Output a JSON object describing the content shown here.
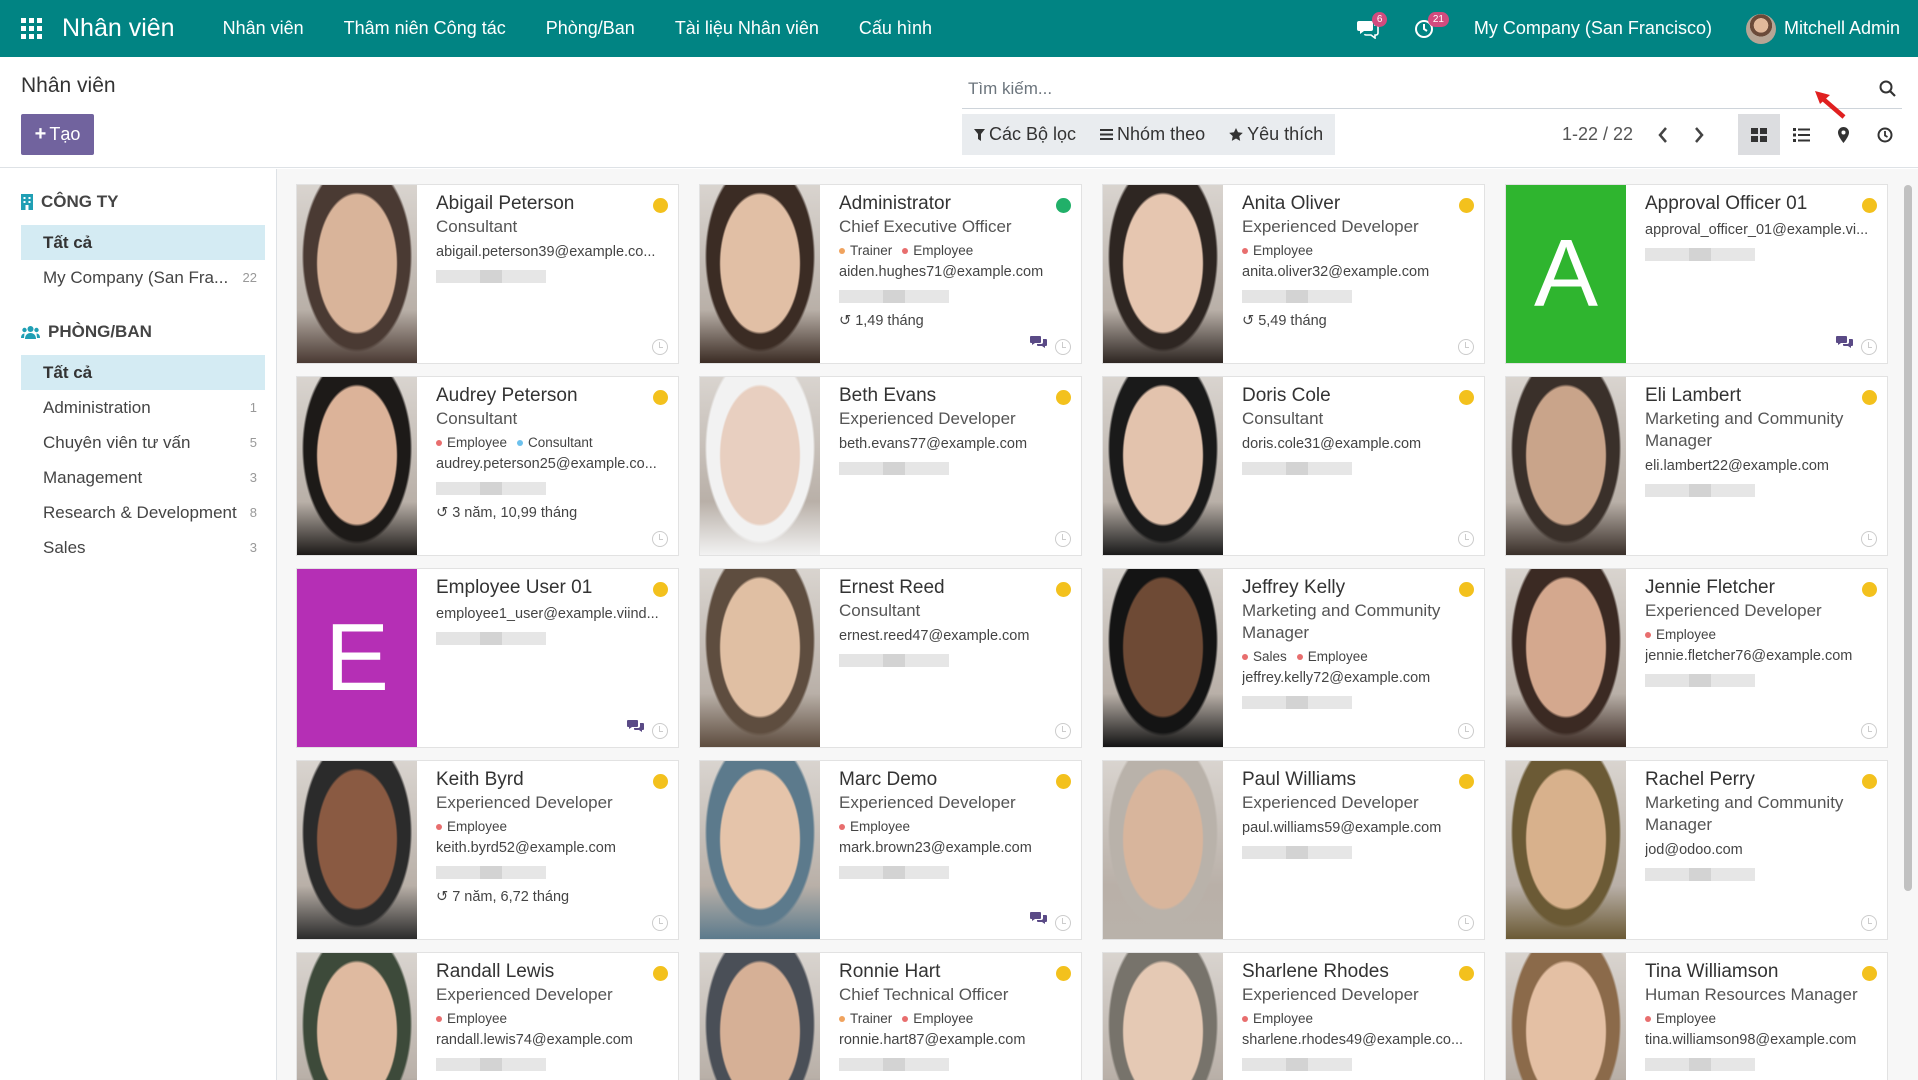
{
  "navbar": {
    "app_name": "Nhân viên",
    "menu": [
      "Nhân viên",
      "Thâm niên Công tác",
      "Phòng/Ban",
      "Tài liệu Nhân viên",
      "Cấu hình"
    ],
    "messages_count": "6",
    "activities_count": "21",
    "company": "My Company (San Francisco)",
    "user": "Mitchell Admin"
  },
  "control": {
    "breadcrumb": "Nhân viên",
    "create_label": "Tạo",
    "search_placeholder": "Tìm kiếm...",
    "filters_label": "Các Bộ lọc",
    "groupby_label": "Nhóm theo",
    "favorites_label": "Yêu thích",
    "pager": "1-22 / 22"
  },
  "sidebar": {
    "company_title": "CÔNG TY",
    "company_items": [
      {
        "label": "Tất cả",
        "count": ""
      },
      {
        "label": "My Company (San Fra...",
        "count": "22"
      }
    ],
    "dept_title": "PHÒNG/BAN",
    "dept_items": [
      {
        "label": "Tất cả",
        "count": ""
      },
      {
        "label": "Administration",
        "count": "1"
      },
      {
        "label": "Chuyên viên tư vấn",
        "count": "5"
      },
      {
        "label": "Management",
        "count": "3"
      },
      {
        "label": "Research & Development",
        "count": "8"
      },
      {
        "label": "Sales",
        "count": "3"
      }
    ]
  },
  "colors": {
    "brand": "#018483",
    "primary": "#71639e",
    "status_away": "#f3c11d",
    "status_online": "#21b069",
    "tag_trainer": "#f0a35e",
    "tag_employee": "#e86e6e",
    "tag_consultant": "#6cc1ed",
    "tag_sales": "#e86e6e"
  },
  "employees": [
    {
      "name": "Abigail Peterson",
      "job": "Consultant",
      "tags": [],
      "email": "abigail.peterson39@example.co...",
      "tenure": "",
      "status": "away",
      "chat": false
    },
    {
      "name": "Administrator",
      "job": "Chief Executive Officer",
      "tags": [
        {
          "label": "Trainer",
          "color": "#f0a35e"
        },
        {
          "label": "Employee",
          "color": "#e86e6e"
        }
      ],
      "email": "aiden.hughes71@example.com",
      "tenure": "1,49 tháng",
      "status": "online",
      "chat": true
    },
    {
      "name": "Anita Oliver",
      "job": "Experienced Developer",
      "tags": [
        {
          "label": "Employee",
          "color": "#e86e6e"
        }
      ],
      "email": "anita.oliver32@example.com",
      "tenure": "5,49 tháng",
      "status": "away",
      "chat": false
    },
    {
      "name": "Approval Officer 01",
      "job": "",
      "tags": [],
      "email": "approval_officer_01@example.vi...",
      "tenure": "",
      "status": "away",
      "chat": true,
      "initial": "A",
      "initial_color": "#2fb52f"
    },
    {
      "name": "Audrey Peterson",
      "job": "Consultant",
      "tags": [
        {
          "label": "Employee",
          "color": "#e86e6e"
        },
        {
          "label": "Consultant",
          "color": "#6cc1ed"
        }
      ],
      "email": "audrey.peterson25@example.co...",
      "tenure": "3 năm, 10,99 tháng",
      "status": "away",
      "chat": false
    },
    {
      "name": "Beth Evans",
      "job": "Experienced Developer",
      "tags": [],
      "email": "beth.evans77@example.com",
      "tenure": "",
      "status": "away",
      "chat": false
    },
    {
      "name": "Doris Cole",
      "job": "Consultant",
      "tags": [],
      "email": "doris.cole31@example.com",
      "tenure": "",
      "status": "away",
      "chat": false
    },
    {
      "name": "Eli Lambert",
      "job": "Marketing and Community Manager",
      "tags": [],
      "email": "eli.lambert22@example.com",
      "tenure": "",
      "status": "away",
      "chat": false
    },
    {
      "name": "Employee User 01",
      "job": "",
      "tags": [],
      "email": "employee1_user@example.viind...",
      "tenure": "",
      "status": "away",
      "chat": true,
      "initial": "E",
      "initial_color": "#b52fb5"
    },
    {
      "name": "Ernest Reed",
      "job": "Consultant",
      "tags": [],
      "email": "ernest.reed47@example.com",
      "tenure": "",
      "status": "away",
      "chat": false
    },
    {
      "name": "Jeffrey Kelly",
      "job": "Marketing and Community Manager",
      "tags": [
        {
          "label": "Sales",
          "color": "#e86e6e"
        },
        {
          "label": "Employee",
          "color": "#e86e6e"
        }
      ],
      "email": "jeffrey.kelly72@example.com",
      "tenure": "",
      "status": "away",
      "chat": false
    },
    {
      "name": "Jennie Fletcher",
      "job": "Experienced Developer",
      "tags": [
        {
          "label": "Employee",
          "color": "#e86e6e"
        }
      ],
      "email": "jennie.fletcher76@example.com",
      "tenure": "",
      "status": "away",
      "chat": false
    },
    {
      "name": "Keith Byrd",
      "job": "Experienced Developer",
      "tags": [
        {
          "label": "Employee",
          "color": "#e86e6e"
        }
      ],
      "email": "keith.byrd52@example.com",
      "tenure": "7 năm, 6,72 tháng",
      "status": "away",
      "chat": false
    },
    {
      "name": "Marc Demo",
      "job": "Experienced Developer",
      "tags": [
        {
          "label": "Employee",
          "color": "#e86e6e"
        }
      ],
      "email": "mark.brown23@example.com",
      "tenure": "",
      "status": "away",
      "chat": true
    },
    {
      "name": "Paul Williams",
      "job": "Experienced Developer",
      "tags": [],
      "email": "paul.williams59@example.com",
      "tenure": "",
      "status": "away",
      "chat": false
    },
    {
      "name": "Rachel Perry",
      "job": "Marketing and Community Manager",
      "tags": [],
      "email": "jod@odoo.com",
      "tenure": "",
      "status": "away",
      "chat": false
    },
    {
      "name": "Randall Lewis",
      "job": "Experienced Developer",
      "tags": [
        {
          "label": "Employee",
          "color": "#e86e6e"
        }
      ],
      "email": "randall.lewis74@example.com",
      "tenure": "",
      "status": "away",
      "chat": false
    },
    {
      "name": "Ronnie Hart",
      "job": "Chief Technical Officer",
      "tags": [
        {
          "label": "Trainer",
          "color": "#f0a35e"
        },
        {
          "label": "Employee",
          "color": "#e86e6e"
        }
      ],
      "email": "ronnie.hart87@example.com",
      "tenure": "",
      "status": "away",
      "chat": false
    },
    {
      "name": "Sharlene Rhodes",
      "job": "Experienced Developer",
      "tags": [
        {
          "label": "Employee",
          "color": "#e86e6e"
        }
      ],
      "email": "sharlene.rhodes49@example.co...",
      "tenure": "",
      "status": "away",
      "chat": false
    },
    {
      "name": "Tina Williamson",
      "job": "Human Resources Manager",
      "tags": [
        {
          "label": "Employee",
          "color": "#e86e6e"
        }
      ],
      "email": "tina.williamson98@example.com",
      "tenure": "",
      "status": "away",
      "chat": false
    }
  ]
}
